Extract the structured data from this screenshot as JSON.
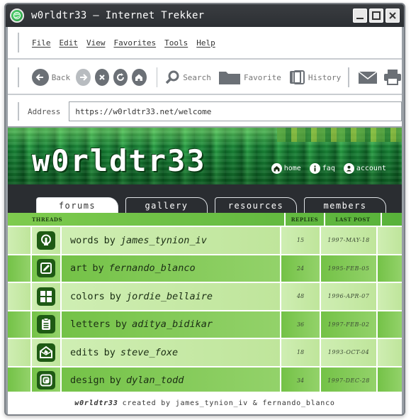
{
  "window": {
    "title": "w0rldtr33 – Internet Trekker",
    "logo_icon": "globe-icon"
  },
  "menu": [
    "File",
    "Edit",
    "View",
    "Favorites",
    "Tools",
    "Help"
  ],
  "toolbar": {
    "back_label": "Back",
    "search_label": "Search",
    "favorite_label": "Favorite",
    "history_label": "History"
  },
  "address": {
    "label": "Address",
    "url": "https://w0rldtr33.net/welcome"
  },
  "site": {
    "logo": "w0rldtr33",
    "nav": [
      {
        "label": "home",
        "icon": "home-icon"
      },
      {
        "label": "faq",
        "icon": "info-icon"
      },
      {
        "label": "account",
        "icon": "user-icon"
      }
    ],
    "tabs": [
      "forums",
      "gallery",
      "resources",
      "members"
    ],
    "active_tab": "forums"
  },
  "table": {
    "headers": {
      "threads": "THREADS",
      "replies": "REPLIES",
      "last_post": "LAST POST"
    },
    "rows": [
      {
        "icon": "lightbulb-icon",
        "topic": "words",
        "by": "by",
        "author": "james_tynion_iv",
        "replies": "15",
        "last_post": "1997-MAY-18"
      },
      {
        "icon": "pencil-icon",
        "topic": "art",
        "by": "by",
        "author": "fernando_blanco",
        "replies": "24",
        "last_post": "1995-FEB-05"
      },
      {
        "icon": "grid-icon",
        "topic": "colors",
        "by": "by",
        "author": "jordie_bellaire",
        "replies": "48",
        "last_post": "1996-APR-07"
      },
      {
        "icon": "clipboard-icon",
        "topic": "letters",
        "by": "by",
        "author": "aditya_bidikar",
        "replies": "36",
        "last_post": "1997-FEB-02"
      },
      {
        "icon": "mail-edit-icon",
        "topic": "edits",
        "by": "by",
        "author": "steve_foxe",
        "replies": "18",
        "last_post": "1993-OCT-04"
      },
      {
        "icon": "design-icon",
        "topic": "design",
        "by": "by",
        "author": "dylan_todd",
        "replies": "34",
        "last_post": "1997-DEC-28"
      }
    ]
  },
  "footer": {
    "brand": "w0rldtr33",
    "text": "created by james_tynion_iv & fernando_blanco"
  },
  "colors": {
    "accent_green": "#58b23a",
    "dark_green": "#1e5a14",
    "titlebar": "#2c2f33"
  }
}
